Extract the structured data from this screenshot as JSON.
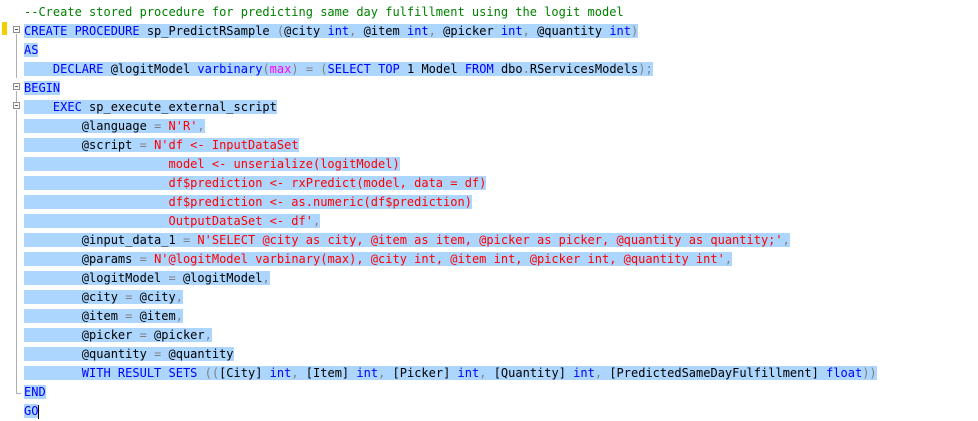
{
  "editor": {
    "lines": [
      {
        "selected": false,
        "tokens": [
          {
            "c": "cmt",
            "t": "--Create stored procedure for predicting same day fulfillment using the logit model"
          }
        ]
      },
      {
        "selected": true,
        "tokens": [
          {
            "c": "kw",
            "t": "CREATE PROCEDURE"
          },
          {
            "c": "plain",
            "t": " sp_PredictRSample "
          },
          {
            "c": "op",
            "t": "("
          },
          {
            "c": "plain",
            "t": "@city "
          },
          {
            "c": "kw",
            "t": "int"
          },
          {
            "c": "op",
            "t": ","
          },
          {
            "c": "plain",
            "t": " @item "
          },
          {
            "c": "kw",
            "t": "int"
          },
          {
            "c": "op",
            "t": ","
          },
          {
            "c": "plain",
            "t": " @picker "
          },
          {
            "c": "kw",
            "t": "int"
          },
          {
            "c": "op",
            "t": ","
          },
          {
            "c": "plain",
            "t": " @quantity "
          },
          {
            "c": "kw",
            "t": "int"
          },
          {
            "c": "op",
            "t": ")"
          }
        ]
      },
      {
        "selected": true,
        "tokens": [
          {
            "c": "kw",
            "t": "AS"
          }
        ]
      },
      {
        "selected": true,
        "tokens": [
          {
            "c": "plain",
            "t": "    "
          },
          {
            "c": "kw",
            "t": "DECLARE"
          },
          {
            "c": "plain",
            "t": " @logitModel "
          },
          {
            "c": "kw",
            "t": "varbinary"
          },
          {
            "c": "op",
            "t": "("
          },
          {
            "c": "sys",
            "t": "max"
          },
          {
            "c": "op",
            "t": ")"
          },
          {
            "c": "plain",
            "t": " "
          },
          {
            "c": "op",
            "t": "="
          },
          {
            "c": "plain",
            "t": " "
          },
          {
            "c": "op",
            "t": "("
          },
          {
            "c": "kw",
            "t": "SELECT TOP"
          },
          {
            "c": "plain",
            "t": " 1 Model "
          },
          {
            "c": "kw",
            "t": "FROM"
          },
          {
            "c": "plain",
            "t": " dbo"
          },
          {
            "c": "op",
            "t": "."
          },
          {
            "c": "plain",
            "t": "RServicesModels"
          },
          {
            "c": "op",
            "t": ");"
          }
        ]
      },
      {
        "selected": true,
        "tokens": [
          {
            "c": "kw",
            "t": "BEGIN"
          }
        ]
      },
      {
        "selected": true,
        "tokens": [
          {
            "c": "plain",
            "t": "    "
          },
          {
            "c": "kw",
            "t": "EXEC"
          },
          {
            "c": "plain",
            "t": " sp_execute_external_script"
          }
        ]
      },
      {
        "selected": true,
        "tokens": [
          {
            "c": "plain",
            "t": "        @language "
          },
          {
            "c": "op",
            "t": "="
          },
          {
            "c": "plain",
            "t": " "
          },
          {
            "c": "str",
            "t": "N'R'"
          },
          {
            "c": "op",
            "t": ","
          }
        ]
      },
      {
        "selected": true,
        "tokens": [
          {
            "c": "plain",
            "t": "        @script "
          },
          {
            "c": "op",
            "t": "="
          },
          {
            "c": "plain",
            "t": " "
          },
          {
            "c": "str",
            "t": "N'df <- InputDataSet"
          }
        ]
      },
      {
        "selected": true,
        "tokens": [
          {
            "c": "str",
            "t": "                    model <- unserialize(logitModel)"
          }
        ]
      },
      {
        "selected": true,
        "tokens": [
          {
            "c": "str",
            "t": "                    df$prediction <- rxPredict(model, data = df)"
          }
        ]
      },
      {
        "selected": true,
        "tokens": [
          {
            "c": "str",
            "t": "                    df$prediction <- as.numeric(df$prediction)"
          }
        ]
      },
      {
        "selected": true,
        "tokens": [
          {
            "c": "str",
            "t": "                    OutputDataSet <- df'"
          },
          {
            "c": "op",
            "t": ","
          }
        ]
      },
      {
        "selected": true,
        "tokens": [
          {
            "c": "plain",
            "t": "        @input_data_1 "
          },
          {
            "c": "op",
            "t": "="
          },
          {
            "c": "plain",
            "t": " "
          },
          {
            "c": "str",
            "t": "N'SELECT @city as city, @item as item, @picker as picker, @quantity as quantity;'"
          },
          {
            "c": "op",
            "t": ","
          }
        ]
      },
      {
        "selected": true,
        "tokens": [
          {
            "c": "plain",
            "t": "        @params "
          },
          {
            "c": "op",
            "t": "="
          },
          {
            "c": "plain",
            "t": " "
          },
          {
            "c": "str",
            "t": "N'@logitModel varbinary(max), @city int, @item int, @picker int, @quantity int'"
          },
          {
            "c": "op",
            "t": ","
          }
        ]
      },
      {
        "selected": true,
        "tokens": [
          {
            "c": "plain",
            "t": "        @logitModel "
          },
          {
            "c": "op",
            "t": "="
          },
          {
            "c": "plain",
            "t": " @logitModel"
          },
          {
            "c": "op",
            "t": ","
          }
        ]
      },
      {
        "selected": true,
        "tokens": [
          {
            "c": "plain",
            "t": "        @city "
          },
          {
            "c": "op",
            "t": "="
          },
          {
            "c": "plain",
            "t": " @city"
          },
          {
            "c": "op",
            "t": ","
          }
        ]
      },
      {
        "selected": true,
        "tokens": [
          {
            "c": "plain",
            "t": "        @item "
          },
          {
            "c": "op",
            "t": "="
          },
          {
            "c": "plain",
            "t": " @item"
          },
          {
            "c": "op",
            "t": ","
          }
        ]
      },
      {
        "selected": true,
        "tokens": [
          {
            "c": "plain",
            "t": "        @picker "
          },
          {
            "c": "op",
            "t": "="
          },
          {
            "c": "plain",
            "t": " @picker"
          },
          {
            "c": "op",
            "t": ","
          }
        ]
      },
      {
        "selected": true,
        "tokens": [
          {
            "c": "plain",
            "t": "        @quantity "
          },
          {
            "c": "op",
            "t": "="
          },
          {
            "c": "plain",
            "t": " @quantity"
          }
        ]
      },
      {
        "selected": true,
        "tokens": [
          {
            "c": "plain",
            "t": "        "
          },
          {
            "c": "kw",
            "t": "WITH RESULT SETS"
          },
          {
            "c": "plain",
            "t": " "
          },
          {
            "c": "op",
            "t": "(("
          },
          {
            "c": "plain",
            "t": "[City] "
          },
          {
            "c": "kw",
            "t": "int"
          },
          {
            "c": "op",
            "t": ","
          },
          {
            "c": "plain",
            "t": " [Item] "
          },
          {
            "c": "kw",
            "t": "int"
          },
          {
            "c": "op",
            "t": ","
          },
          {
            "c": "plain",
            "t": " [Picker] "
          },
          {
            "c": "kw",
            "t": "int"
          },
          {
            "c": "op",
            "t": ","
          },
          {
            "c": "plain",
            "t": " [Quantity] "
          },
          {
            "c": "kw",
            "t": "int"
          },
          {
            "c": "op",
            "t": ","
          },
          {
            "c": "plain",
            "t": " [PredictedSameDayFulfillment] "
          },
          {
            "c": "kw",
            "t": "float"
          },
          {
            "c": "op",
            "t": "))"
          }
        ]
      },
      {
        "selected": true,
        "tokens": [
          {
            "c": "kw",
            "t": "END"
          }
        ]
      },
      {
        "selected": true,
        "caret": true,
        "tokens": [
          {
            "c": "kw",
            "t": "GO"
          }
        ]
      }
    ]
  },
  "colors": {
    "keyword": "#0000ff",
    "string": "#ff0000",
    "comment": "#008000",
    "operator": "#808080",
    "system_function": "#ff00ff",
    "selection": "#add6ff",
    "change_marker": "#f2d000"
  },
  "icons": {
    "fold_toggle": "fold-collapse-icon",
    "change_marker": "change-marker-icon"
  }
}
